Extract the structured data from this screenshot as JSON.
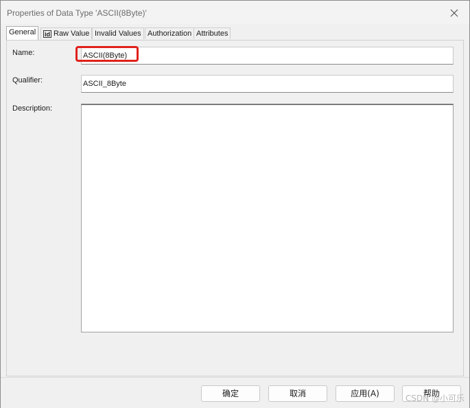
{
  "window": {
    "title": "Properties of Data Type 'ASCII(8Byte)'"
  },
  "tabs": [
    {
      "label": "General",
      "active": true
    },
    {
      "label": "Raw Value",
      "icon": "id-icon",
      "icon_text": "id"
    },
    {
      "label": "Invalid Values"
    },
    {
      "label": "Authorization"
    },
    {
      "label": "Attributes"
    }
  ],
  "form": {
    "name_label": "Name:",
    "name_value": "ASCII(8Byte)",
    "qualifier_label": "Qualifier:",
    "qualifier_value": "ASCII_8Byte",
    "description_label": "Description:",
    "description_value": ""
  },
  "buttons": {
    "ok": "确定",
    "cancel": "取消",
    "apply": "应用(A)",
    "help": "帮助"
  },
  "watermark": "CSDN @小可乐",
  "colors": {
    "highlight": "#e0201b"
  }
}
